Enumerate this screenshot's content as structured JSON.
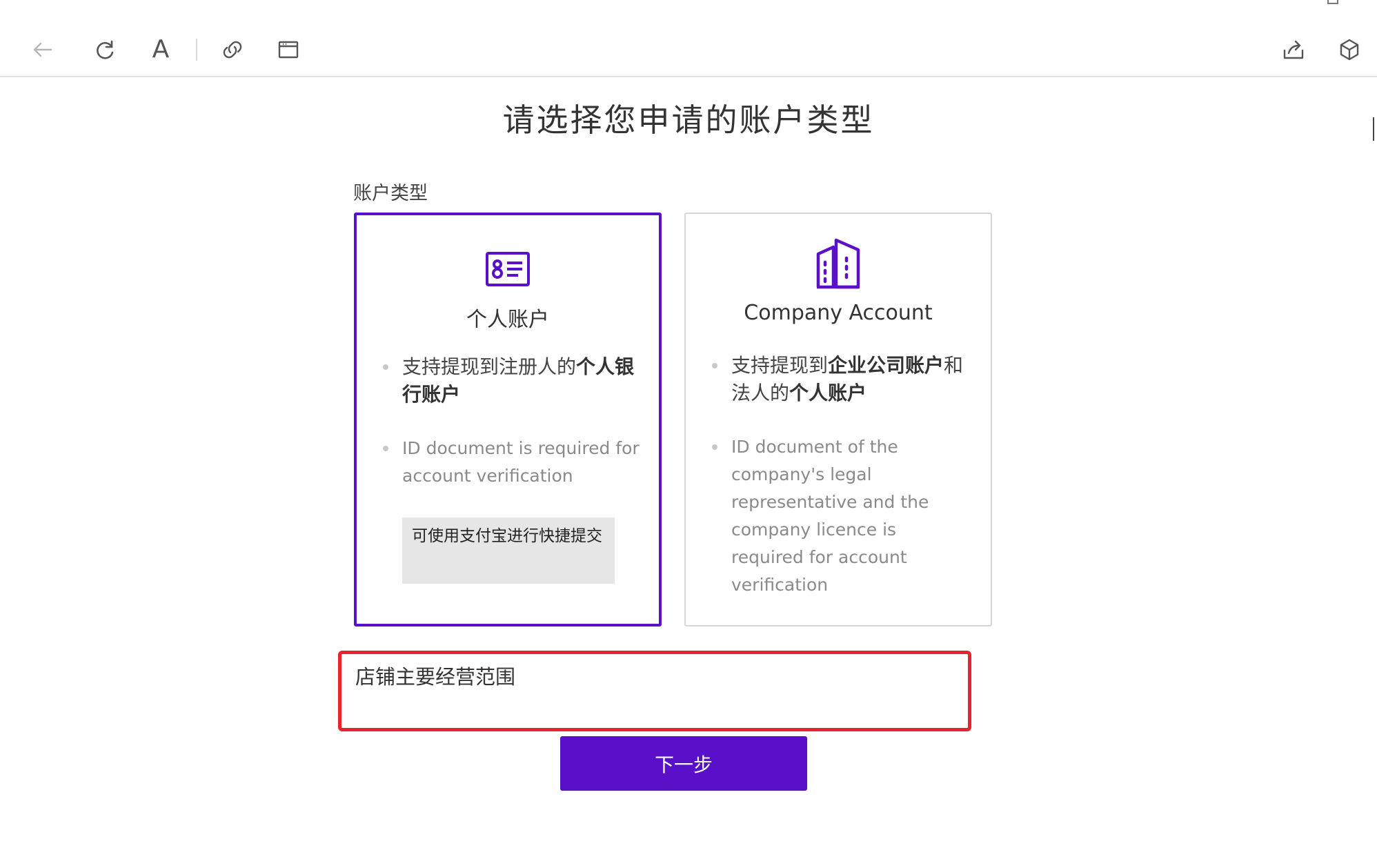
{
  "toolbar": {
    "font_label": "A"
  },
  "page": {
    "title": "请选择您申请的账户类型",
    "section_label": "账户类型"
  },
  "cards": [
    {
      "icon": "id-card-icon",
      "title": "个人账户",
      "selected": true,
      "bullets": [
        {
          "parts": [
            "支持提现到注册人的",
            "个人银行账户"
          ]
        },
        {
          "text": "ID document is required for account verification"
        }
      ],
      "alipay_note": "可使用支付宝进行快捷提交"
    },
    {
      "icon": "buildings-icon",
      "title": "Company Account",
      "selected": false,
      "bullets": [
        {
          "parts": [
            "支持提现到",
            "企业公司账户",
            "和法人的",
            "个人账户"
          ]
        },
        {
          "text": "ID document of the company's legal representative and the company licence is required for account verification"
        }
      ]
    }
  ],
  "business_scope": {
    "label": "店铺主要经营范围"
  },
  "next_button": {
    "label": "下一步"
  },
  "colors": {
    "accent": "#5a0fc8",
    "highlight": "#e8232e",
    "note_bg": "#e6e6e6"
  }
}
